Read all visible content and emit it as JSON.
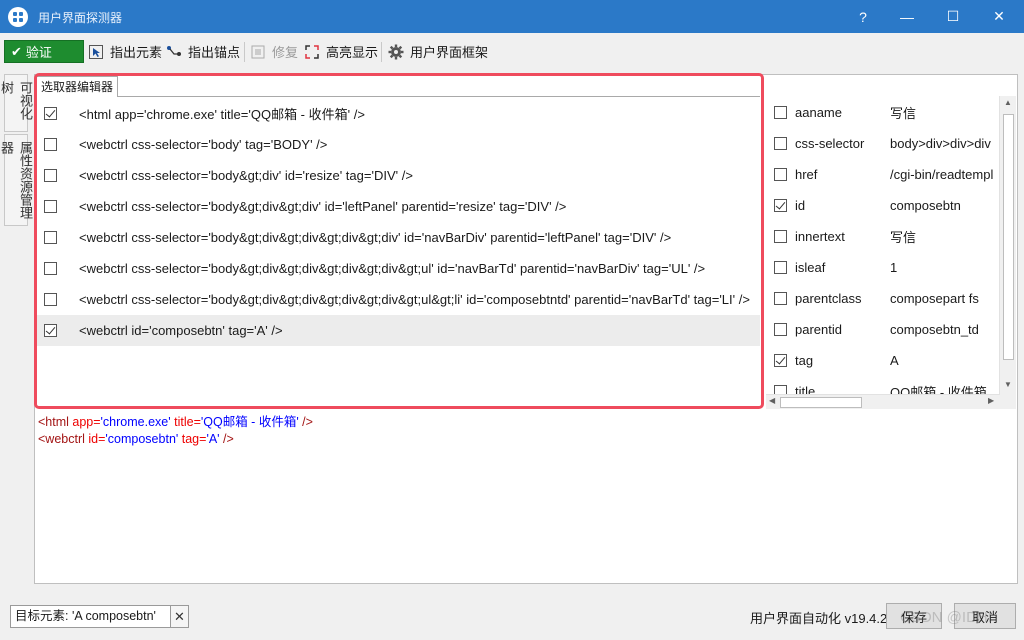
{
  "window": {
    "title": "用户界面探测器",
    "help": "?",
    "minimize": "—",
    "maximize": "☐",
    "close": "✕"
  },
  "toolbar": {
    "verify": "验证",
    "indicate_element": "指出元素",
    "indicate_anchor": "指出锚点",
    "repair": "修复",
    "highlight": "高亮显示",
    "ui_frameworks": "用户界面框架"
  },
  "side_tabs": {
    "visual_tree": "可视化树",
    "property_explorer": "属性资源管理器"
  },
  "editor": {
    "tab": "选取器编辑器",
    "selectors": [
      {
        "text": "<html app='chrome.exe' title='QQ邮箱 - 收件箱' />",
        "checked": true
      },
      {
        "text": "<webctrl css-selector='body' tag='BODY' />",
        "checked": false
      },
      {
        "text": "<webctrl css-selector='body&gt;div' id='resize' tag='DIV' />",
        "checked": false
      },
      {
        "text": "<webctrl css-selector='body&gt;div&gt;div' id='leftPanel' parentid='resize' tag='DIV' />",
        "checked": false
      },
      {
        "text": "<webctrl css-selector='body&gt;div&gt;div&gt;div&gt;div' id='navBarDiv' parentid='leftPanel' tag='DIV' />",
        "checked": false
      },
      {
        "text": "<webctrl css-selector='body&gt;div&gt;div&gt;div&gt;div&gt;ul' id='navBarTd' parentid='navBarDiv' tag='UL' />",
        "checked": false
      },
      {
        "text": "<webctrl css-selector='body&gt;div&gt;div&gt;div&gt;div&gt;ul&gt;li' id='composebtntd' parentid='navBarTd' tag='LI' />",
        "checked": false
      },
      {
        "text": "<webctrl id='composebtn' tag='A' />",
        "checked": true
      }
    ]
  },
  "attributes": [
    {
      "name": "aaname",
      "value": "写信",
      "checked": false
    },
    {
      "name": "css-selector",
      "value": "body>div>div>div",
      "checked": false
    },
    {
      "name": "href",
      "value": "/cgi-bin/readtempl",
      "checked": false
    },
    {
      "name": "id",
      "value": "composebtn",
      "checked": true
    },
    {
      "name": "innertext",
      "value": "写信",
      "checked": false
    },
    {
      "name": "isleaf",
      "value": "1",
      "checked": false
    },
    {
      "name": "parentclass",
      "value": "composepart fs",
      "checked": false
    },
    {
      "name": "parentid",
      "value": "composebtn_td",
      "checked": false
    },
    {
      "name": "tag",
      "value": "A",
      "checked": true
    },
    {
      "name": "title",
      "value": "QQ邮箱 - 收件箱",
      "checked": false
    }
  ],
  "code": {
    "line1": {
      "open": "<html ",
      "a1": "app=",
      "v1": "'chrome.exe'",
      "a2": " title=",
      "v2": "'QQ邮箱 - 收件箱'",
      "close": " />"
    },
    "line2": {
      "open": "<webctrl ",
      "a1": "id=",
      "v1": "'composebtn'",
      "a2": " tag=",
      "v2": "'A'",
      "close": " />"
    }
  },
  "footer": {
    "target_label": "目标元素: 'A  composebtn'",
    "clear": "✕",
    "version": "用户界面自动化 v19.4.2",
    "save": "保存",
    "cancel": "取消",
    "watermark": "CSDN @IDHI"
  },
  "colors": {
    "titlebar": "#2b79c8",
    "verify_green": "#1e8c2f",
    "highlight_red": "#ef4b5d"
  }
}
